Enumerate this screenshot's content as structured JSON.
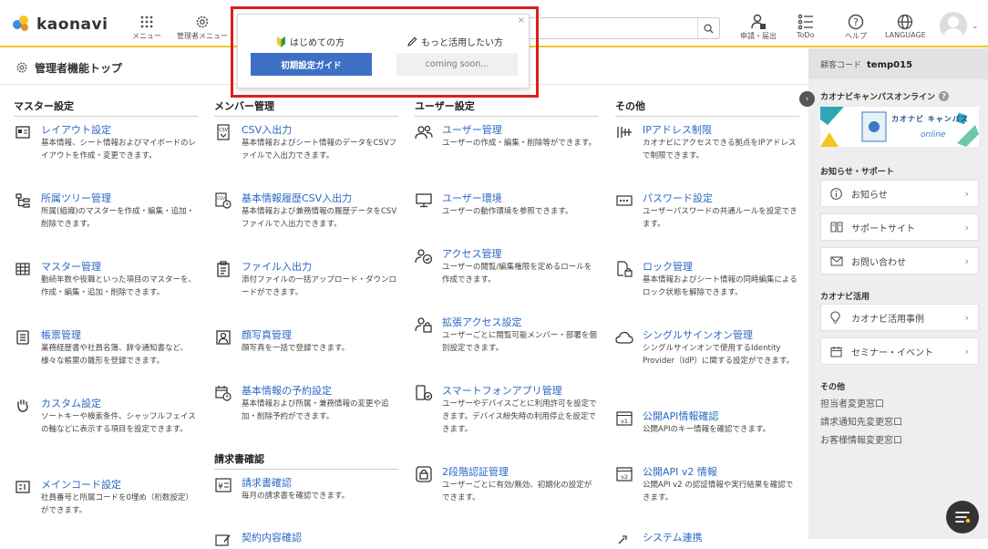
{
  "brand": {
    "logo_text": "kaonavi"
  },
  "topbar": {
    "menu_label": "メニュー",
    "admin_menu_label": "管理者メニュー",
    "apply_label": "申請・届出",
    "todo_label": "ToDo",
    "help_label": "ヘルプ",
    "language_label": "LANGUAGE"
  },
  "subheader": {
    "title": "管理者機能トップ"
  },
  "popup": {
    "first_label": "はじめての方",
    "more_label": "もっと活用したい方",
    "guide_button": "初期設定ガイド",
    "coming_soon": "coming soon...",
    "close": "×"
  },
  "columns": {
    "master": {
      "heading": "マスター設定",
      "items": [
        {
          "title": "レイアウト設定",
          "desc": "基本情報、シート情報およびマイボードのレイアウトを作成・変更できます。"
        },
        {
          "title": "所属ツリー管理",
          "desc": "所属(組織)のマスターを作成・編集・追加・削除できます。"
        },
        {
          "title": "マスター管理",
          "desc": "勤続年数や役職といった項目のマスターを、作成・編集・追加・削除できます。"
        },
        {
          "title": "帳票管理",
          "desc": "業務経歴書や社員名簿、辞令通知書など、様々な帳票の雛形を登録できます。"
        },
        {
          "title": "カスタム設定",
          "desc": "ソートキーや検索条件、シャッフルフェイスの軸などに表示する項目を設定できます。"
        },
        {
          "title": "メインコード設定",
          "desc": "社員番号と所属コードを0埋め（桁数設定）ができます。"
        }
      ]
    },
    "member": {
      "heading": "メンバー管理",
      "items": [
        {
          "title": "CSV入出力",
          "desc": "基本情報およびシート情報のデータをCSVファイルで入出力できます。"
        },
        {
          "title": "基本情報履歴CSV入出力",
          "desc": "基本情報および兼務情報の履歴データをCSVファイルで入出力できます。"
        },
        {
          "title": "ファイル入出力",
          "desc": "添付ファイルの一括アップロード・ダウンロードができます。"
        },
        {
          "title": "顔写真管理",
          "desc": "顔写真を一括で登録できます。"
        },
        {
          "title": "基本情報の予約設定",
          "desc": "基本情報および所属・兼務情報の変更や追加・削除予約ができます。"
        }
      ],
      "invoice_heading": "請求書確認",
      "invoice_items": [
        {
          "title": "請求書確認",
          "desc": "毎月の請求書を確認できます。"
        },
        {
          "title": "契約内容確認",
          "desc": ""
        }
      ]
    },
    "user": {
      "heading": "ユーザー設定",
      "items": [
        {
          "title": "ユーザー管理",
          "desc": "ユーザーの作成・編集・削除等ができます。"
        },
        {
          "title": "ユーザー環境",
          "desc": "ユーザーの動作環境を参照できます。"
        },
        {
          "title": "アクセス管理",
          "desc": "ユーザーの閲覧/編集権限を定めるロールを作成できます。"
        },
        {
          "title": "拡張アクセス設定",
          "desc": "ユーザーごとに閲覧可能メンバー・部署を個別設定できます。"
        },
        {
          "title": "スマートフォンアプリ管理",
          "desc": "ユーザーやデバイスごとに利用許可を設定できます。デバイス紛失時の利用停止を設定できます。"
        },
        {
          "title": "2段階認証管理",
          "desc": "ユーザーごとに有効/無効、初期化の設定ができます。"
        }
      ]
    },
    "other": {
      "heading": "その他",
      "items": [
        {
          "title": "IPアドレス制限",
          "desc": "カオナビにアクセスできる拠点をIPアドレスで制限できます。"
        },
        {
          "title": "パスワード設定",
          "desc": "ユーザーパスワードの共通ルールを設定できます。"
        },
        {
          "title": "ロック管理",
          "desc": "基本情報およびシート情報の同時編集によるロック状態を解除できます。"
        },
        {
          "title": "シングルサインオン管理",
          "desc": "シングルサインオンで使用するIdentity Provider（IdP）に関する設定ができます。"
        },
        {
          "title": "公開API情報確認",
          "desc": "公開APIのキー情報を確認できます。"
        },
        {
          "title": "公開API v2 情報",
          "desc": "公開API v2 の認証情報や実行結果を確認できます。"
        },
        {
          "title": "システム連携",
          "desc": ""
        }
      ]
    }
  },
  "sidebar": {
    "customer_code_label": "顧客コード",
    "customer_code": "temp015",
    "campus_title": "カオナビキャンパスオンライン",
    "banner_text": "カオナビ キャンパス",
    "banner_sub": "online",
    "support_heading": "お知らせ・サポート",
    "support_items": [
      {
        "label": "お知らせ"
      },
      {
        "label": "サポートサイト"
      },
      {
        "label": "お問い合わせ"
      }
    ],
    "usage_heading": "カオナビ活用",
    "usage_items": [
      {
        "label": "カオナビ活用事例"
      },
      {
        "label": "セミナー・イベント"
      }
    ],
    "other_heading": "その他",
    "other_links": [
      {
        "label": "担当者変更窓口"
      },
      {
        "label": "請求通知先変更窓口"
      },
      {
        "label": "お客様情報変更窓口"
      }
    ]
  },
  "colors": {
    "accent": "#f3c623",
    "link": "#2b68c5",
    "primary_button": "#3d6fc5",
    "highlight_frame": "#dd1e1e"
  }
}
